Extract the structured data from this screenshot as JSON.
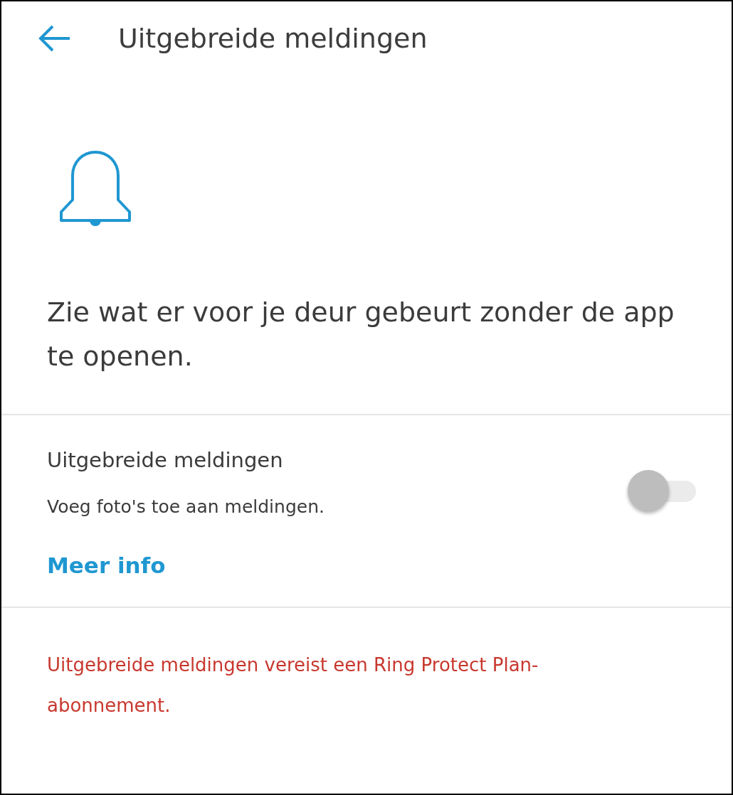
{
  "header": {
    "title": "Uitgebreide meldingen"
  },
  "headline": "Zie wat er voor je deur gebeurt zonder de app te openen.",
  "setting": {
    "title": "Uitgebreide meldingen",
    "description": "Voeg foto's toe aan meldingen.",
    "on": false,
    "link": "Meer info"
  },
  "warning": "Uitgebreide meldingen vereist een Ring Protect Plan-abonnement."
}
